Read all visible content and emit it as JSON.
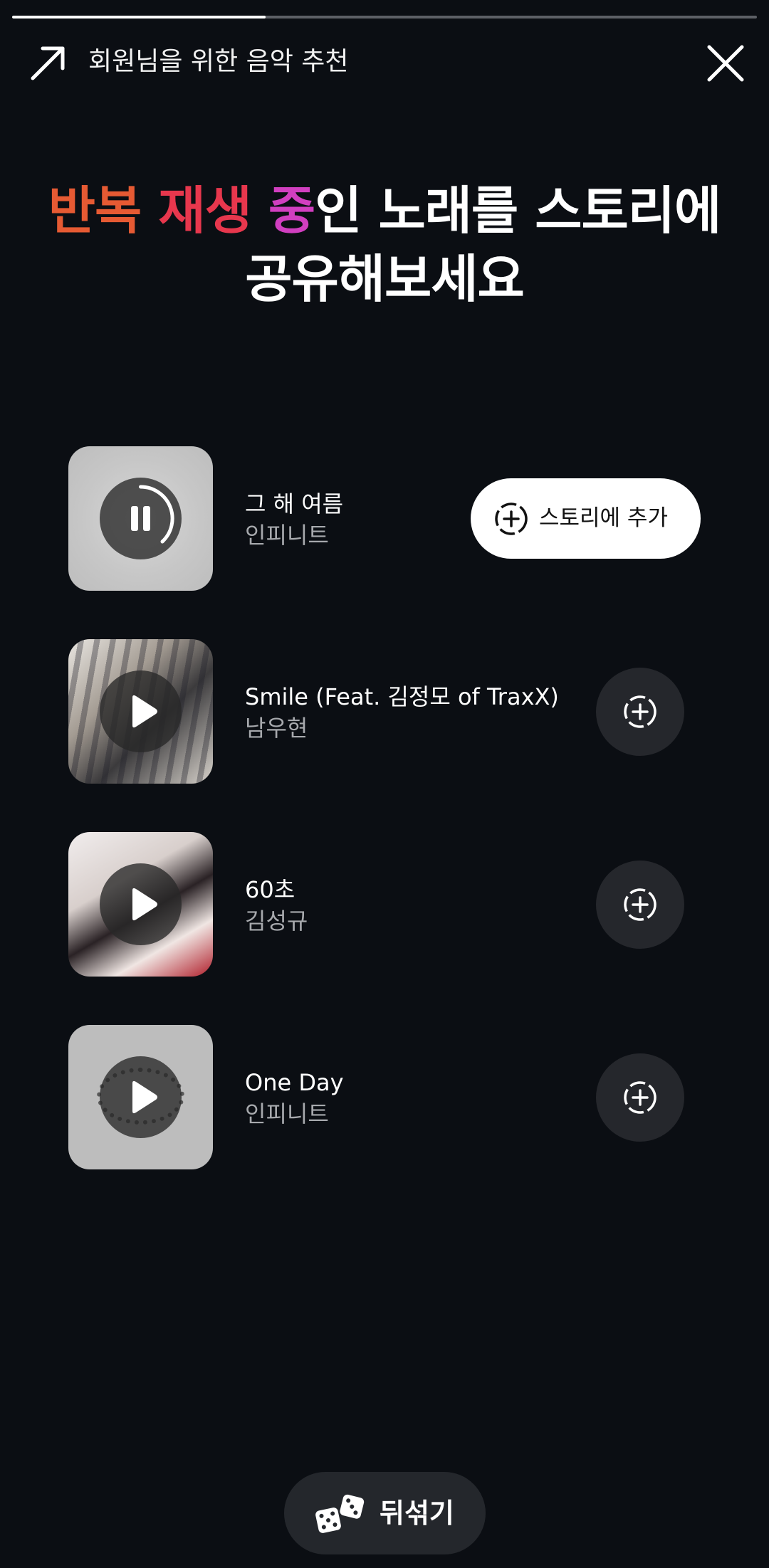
{
  "progress": {
    "fraction": 0.34
  },
  "header": {
    "title": "회원님을 위한 음악 추천",
    "icons": {
      "left": "arrow-up-right-icon",
      "right": "close-icon"
    }
  },
  "headline": {
    "part1": "반복 ",
    "part2": "재생 ",
    "part3": "중",
    "part4": "인 노래를 스토리에",
    "part5": "공유해보세요",
    "colors": {
      "part1": "#e65a33",
      "part2": "#e7374d",
      "part3": "#d13fc0"
    }
  },
  "songs": [
    {
      "title": "그 해 여름",
      "artist": "인피니트",
      "state": "playing",
      "action_label": "스토리에 추가"
    },
    {
      "title": "Smile (Feat. 김정모 of TraxX)",
      "artist": "남우현",
      "state": "paused"
    },
    {
      "title": "60초",
      "artist": "김성규",
      "state": "paused"
    },
    {
      "title": "One Day",
      "artist": "인피니트",
      "state": "paused"
    }
  ],
  "shuffle": {
    "label": "뒤섞기",
    "icon": "dice-icon"
  }
}
